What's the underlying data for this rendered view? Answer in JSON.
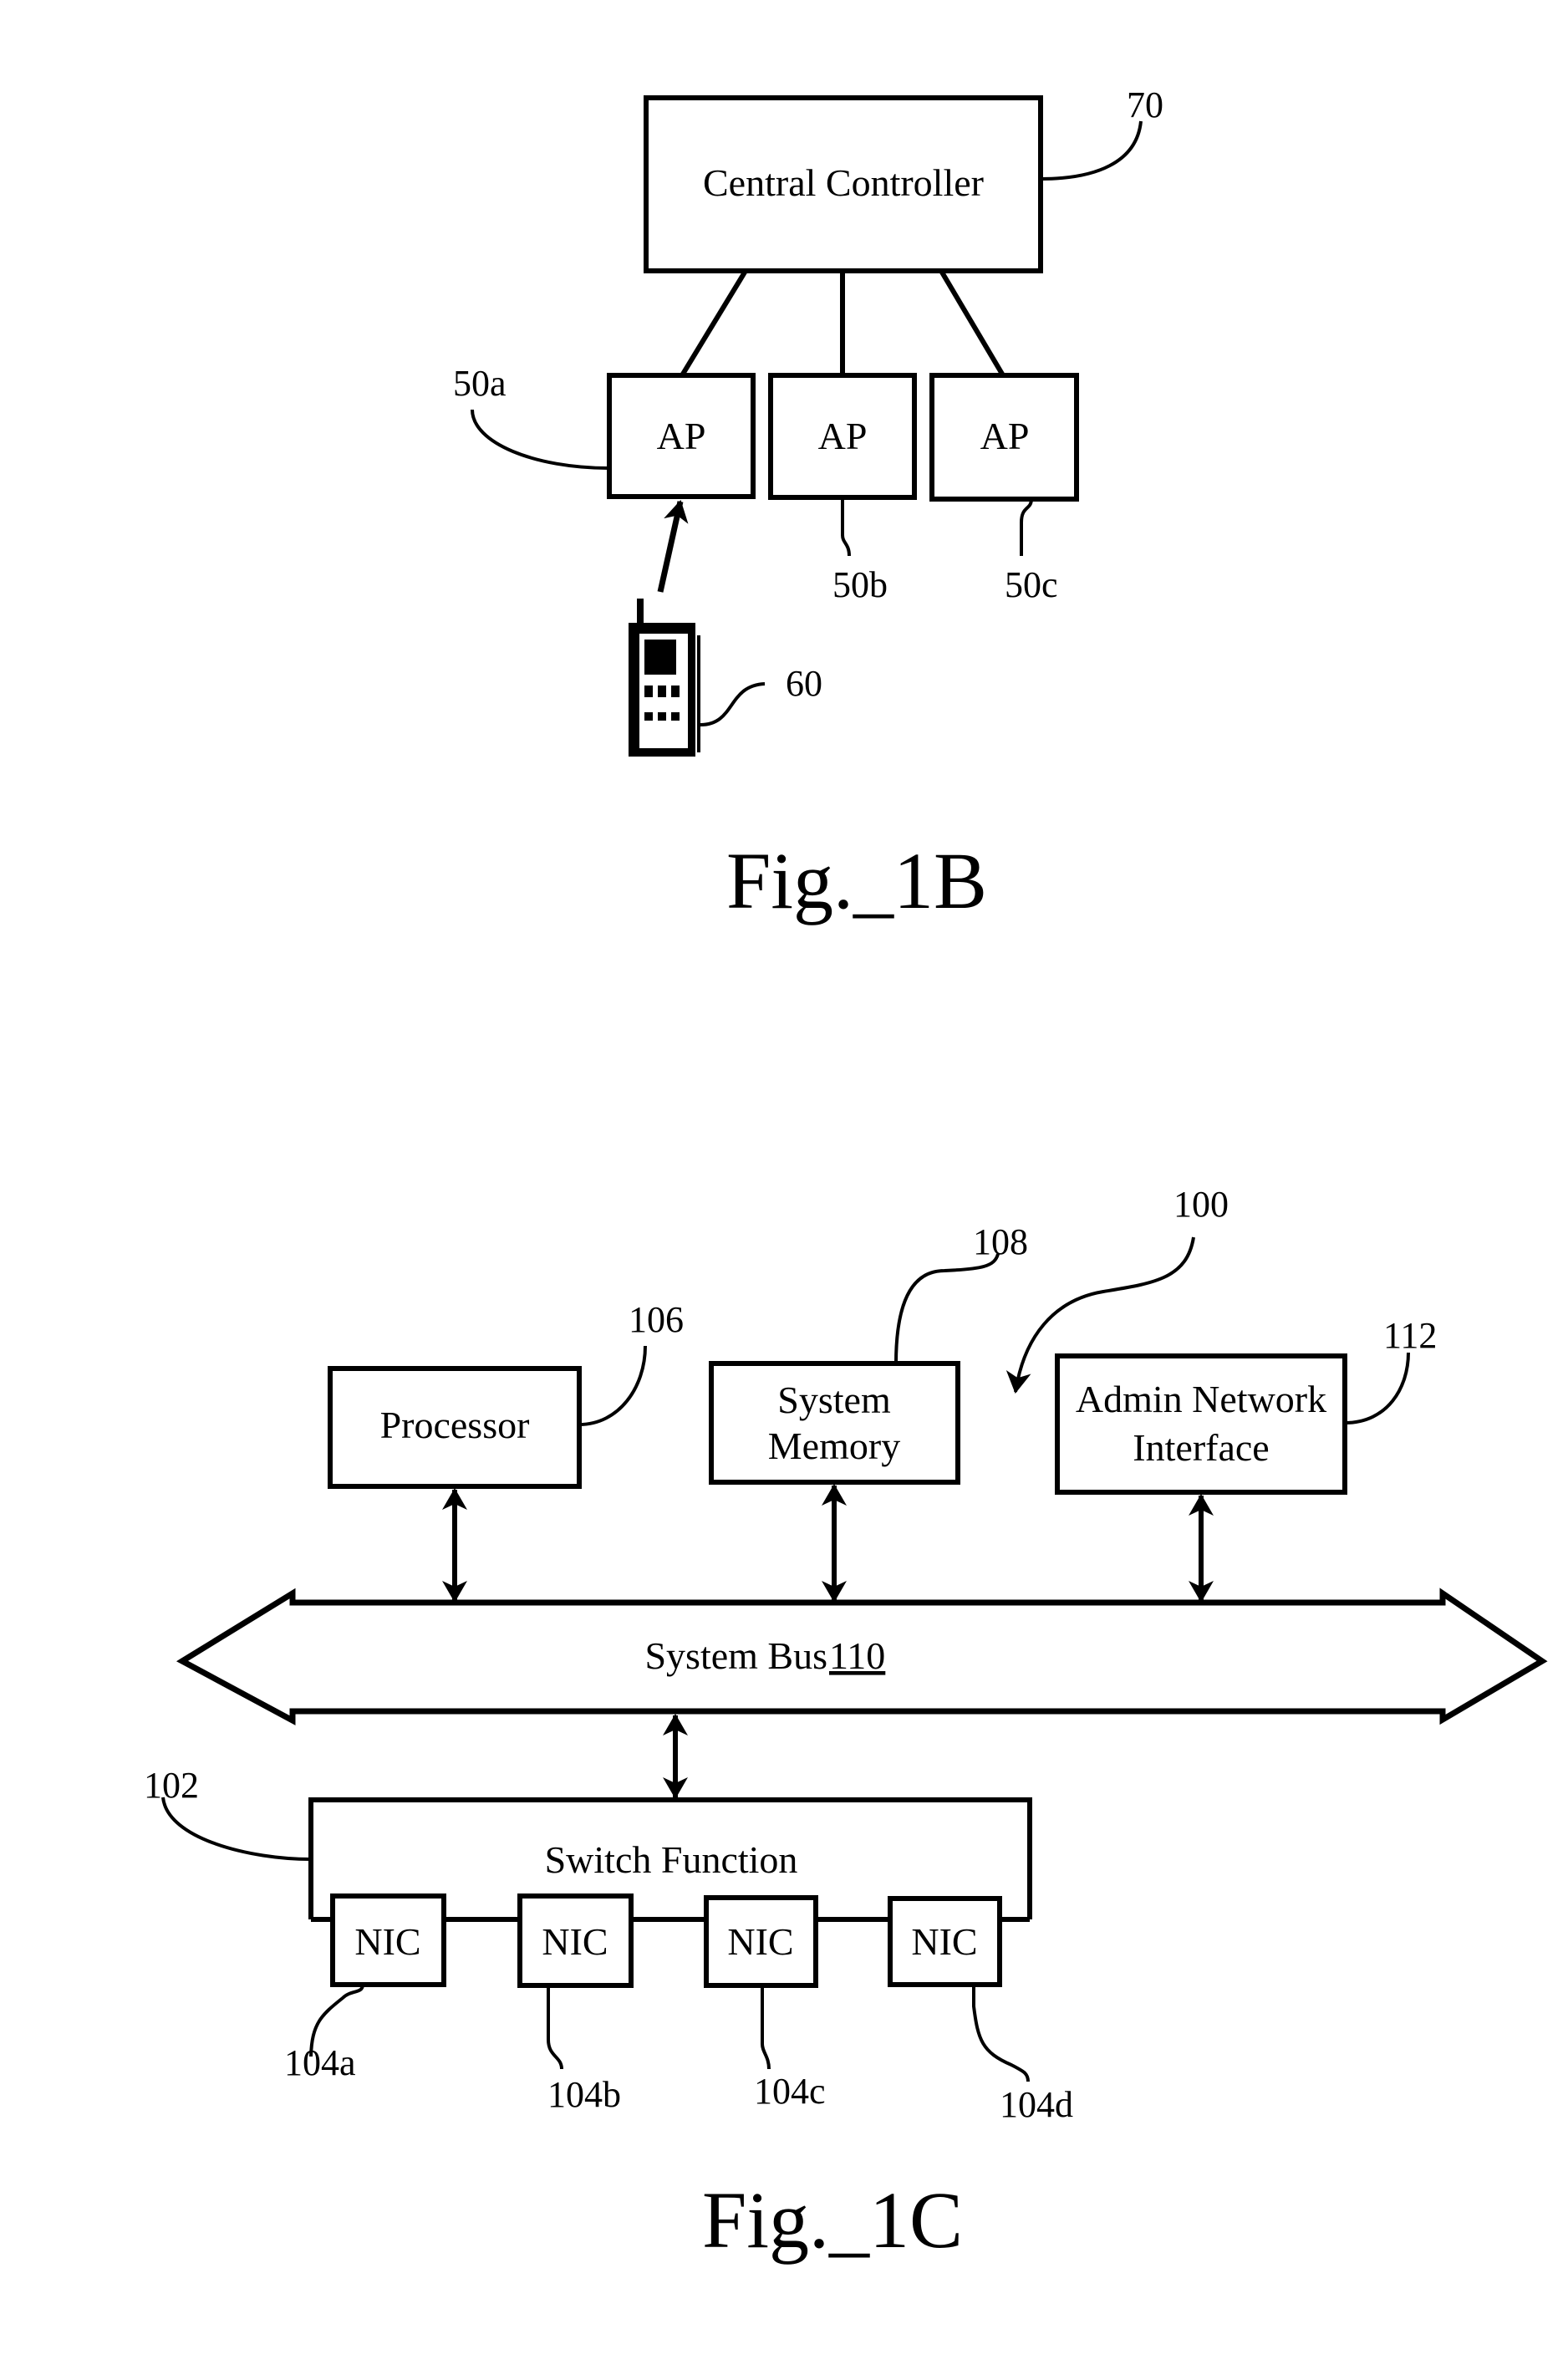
{
  "figures": [
    {
      "caption": "Fig._1B",
      "central_controller": {
        "label": "Central Controller",
        "ref": "70"
      },
      "access_points": [
        {
          "label": "AP",
          "ref": "50a"
        },
        {
          "label": "AP",
          "ref": "50b"
        },
        {
          "label": "AP",
          "ref": "50c"
        }
      ],
      "mobile_device": {
        "icon": "mobile-phone-icon",
        "ref": "60"
      }
    },
    {
      "caption": "Fig._1C",
      "system_ref": "100",
      "processor": {
        "label": "Processor",
        "ref": "106"
      },
      "system_memory": {
        "label_line1": "System",
        "label_line2": "Memory",
        "ref": "108"
      },
      "admin_network_interface": {
        "label_line1": "Admin Network",
        "label_line2": "Interface",
        "ref": "112"
      },
      "system_bus": {
        "label": "System Bus ",
        "ref": "110"
      },
      "switch_function": {
        "label": "Switch Function",
        "ref": "102"
      },
      "nics": [
        {
          "label": "NIC",
          "ref": "104a"
        },
        {
          "label": "NIC",
          "ref": "104b"
        },
        {
          "label": "NIC",
          "ref": "104c"
        },
        {
          "label": "NIC",
          "ref": "104d"
        }
      ]
    }
  ]
}
